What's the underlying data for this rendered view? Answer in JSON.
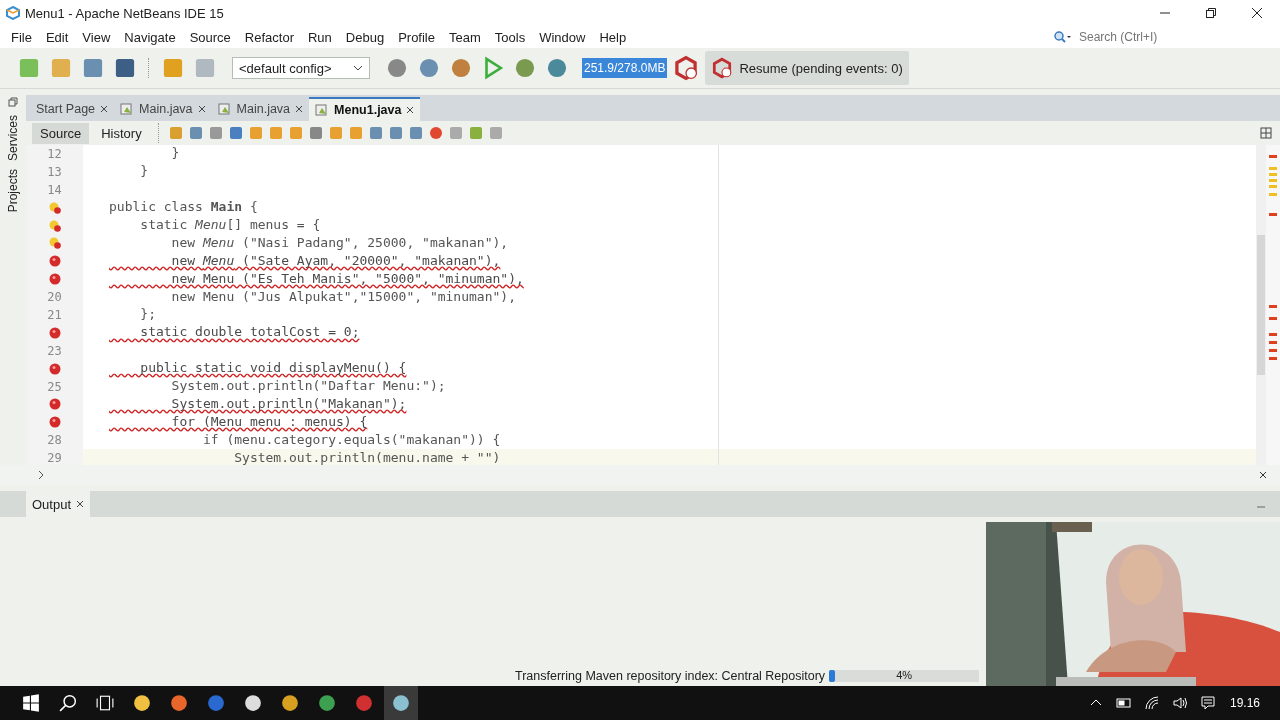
{
  "window": {
    "title": "Menu1 - Apache NetBeans IDE 15"
  },
  "menu": [
    "File",
    "Edit",
    "View",
    "Navigate",
    "Source",
    "Refactor",
    "Run",
    "Debug",
    "Profile",
    "Team",
    "Tools",
    "Window",
    "Help"
  ],
  "search": {
    "placeholder": "Search (Ctrl+I)"
  },
  "toolbar": {
    "config": "<default config>",
    "memory": "251.9/278.0MB",
    "resume": "Resume (pending events: 0)"
  },
  "side_tabs": [
    "Services",
    "Projects"
  ],
  "editor_tabs": [
    {
      "label": "Start Page",
      "selected": false,
      "file": false
    },
    {
      "label": "Main.java",
      "selected": false,
      "file": true
    },
    {
      "label": "Main.java",
      "selected": false,
      "file": true
    },
    {
      "label": "Menu1.java",
      "selected": true,
      "file": true
    }
  ],
  "view_tabs": [
    {
      "label": "Source",
      "selected": true
    },
    {
      "label": "History",
      "selected": false
    }
  ],
  "code": [
    {
      "kind": "numbered",
      "number": "12",
      "text": "        }",
      "error": false,
      "current": false
    },
    {
      "kind": "numbered",
      "number": "13",
      "text": "    }",
      "error": false,
      "current": false
    },
    {
      "kind": "numbered",
      "number": "14",
      "current": false
    },
    {
      "kind": "warning",
      "text": "public class **Main** {",
      "error": false,
      "current": false
    },
    {
      "kind": "warning",
      "text": "    static *Menu*[] menus = {",
      "error": false,
      "current": false
    },
    {
      "kind": "warning",
      "text": "        new *Menu* (\"Nasi Padang\", 25000, \"makanan\"),",
      "error": false,
      "current": false
    },
    {
      "kind": "error",
      "text": "        new *Menu* (\"Sate Ayam, \"20000\", \"makanan\"),",
      "error": true,
      "current": false
    },
    {
      "kind": "error",
      "text": "        new Menu (\"Es Teh Manis\", \"5000\", \"minuman\"),",
      "error": true,
      "current": false
    },
    {
      "kind": "numbered",
      "number": "20",
      "text": "        new Menu (\"Jus Alpukat\",\"15000\", \"minuman\"),",
      "error": false,
      "current": false
    },
    {
      "kind": "numbered",
      "number": "21",
      "text": "    };",
      "error": false,
      "current": false
    },
    {
      "kind": "error",
      "text": "    static double totalCost = 0;",
      "error": true,
      "current": false
    },
    {
      "kind": "numbered",
      "number": "23",
      "current": false
    },
    {
      "kind": "error",
      "text": "    public static void displayMenu() {",
      "error": true,
      "current": false
    },
    {
      "kind": "numbered",
      "number": "25",
      "text": "        System.out.println(\"Daftar Menu:\");",
      "error": false,
      "current": false
    },
    {
      "kind": "error",
      "text": "        System.out.println(\"Makanan\");",
      "error": true,
      "current": false
    },
    {
      "kind": "error",
      "text": "        for (Menu menu : menus) {",
      "error": true,
      "current": false
    },
    {
      "kind": "numbered",
      "number": "28",
      "text": "            if (menu.category.equals(\"makanan\")) {",
      "error": false,
      "current": false
    },
    {
      "kind": "numbered",
      "number": "29",
      "text": "                System.out.println(menu.name + \"\")",
      "error": false,
      "current": true
    }
  ],
  "output": {
    "tab": "Output"
  },
  "status": {
    "text": "Transferring Maven repository index: Central Repository",
    "level": 0.04,
    "percent": "4%"
  },
  "taskbar": {
    "time": "19.16"
  }
}
